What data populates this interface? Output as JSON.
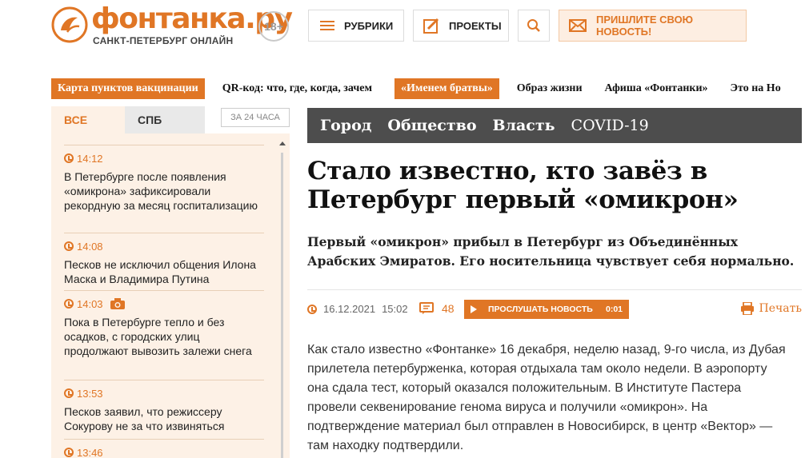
{
  "header": {
    "logo_title": "фонтанка.ру",
    "logo_subtitle": "САНКТ-ПЕТЕРБУРГ ОНЛАЙН",
    "age_rating": "18+",
    "rubrics_label": "РУБРИКИ",
    "projects_label": "ПРОЕКТЫ",
    "send_news_label": "ПРИШЛИТЕ СВОЮ НОВОСТЬ!",
    "accent_color": "#e07625"
  },
  "topnav": {
    "items": [
      "Карта пунктов вакцинации",
      "QR-код: что, где, когда, зачем",
      "«Именем братвы»",
      "Образ жизни",
      "Афиша «Фонтанки»",
      "Это на Но"
    ]
  },
  "sidebar": {
    "tab_all": "ВСЕ",
    "tab_spb": "СПБ",
    "tab_24h": "ЗА 24 ЧАСА",
    "news": [
      {
        "time": "14:12",
        "text": "В Петербурге после появления «омикрона» зафиксировали рекордную за месяц госпитализацию"
      },
      {
        "time": "14:08",
        "text": "Песков не исключил общения Илона Маска и Владимира Путина"
      },
      {
        "time": "14:03",
        "text": "Пока в Петербурге тепло и без осадков, с городских улиц продолжают вывозить залежи снега"
      },
      {
        "time": "13:53",
        "text": "Песков заявил, что режиссеру Сокурову не за что извиняться"
      },
      {
        "time": "13:46",
        "text": ""
      }
    ]
  },
  "article": {
    "rubrics": [
      "Город",
      "Общество",
      "Власть",
      "COVID-19"
    ],
    "title": "Стало известно, кто завёз в Петербург первый «омикрон»",
    "lead": "Первый «омикрон» прибыл в Петербург из Объединённых Арабских Эмиратов. Его носительница чувствует себя нормально.",
    "date": "16.12.2021",
    "time": "15:02",
    "comments_count": "48",
    "listen_label": "ПРОСЛУШАТЬ НОВОСТЬ",
    "listen_duration": "0:01",
    "print_label": "Печать",
    "body": "Как стало известно «Фонтанке» 16 декабря, неделю назад, 9-го числа, из Дубая прилетела петербурженка, которая отдыхала там около недели. В аэропорту она сдала тест, который оказался положительным. В Институте Пастера провели секвенирование генома вируса и получили «омикрон». На подтверждение материал был отправлен в Новосибирск, в центр «Вектор» — там находку подтвердили."
  }
}
